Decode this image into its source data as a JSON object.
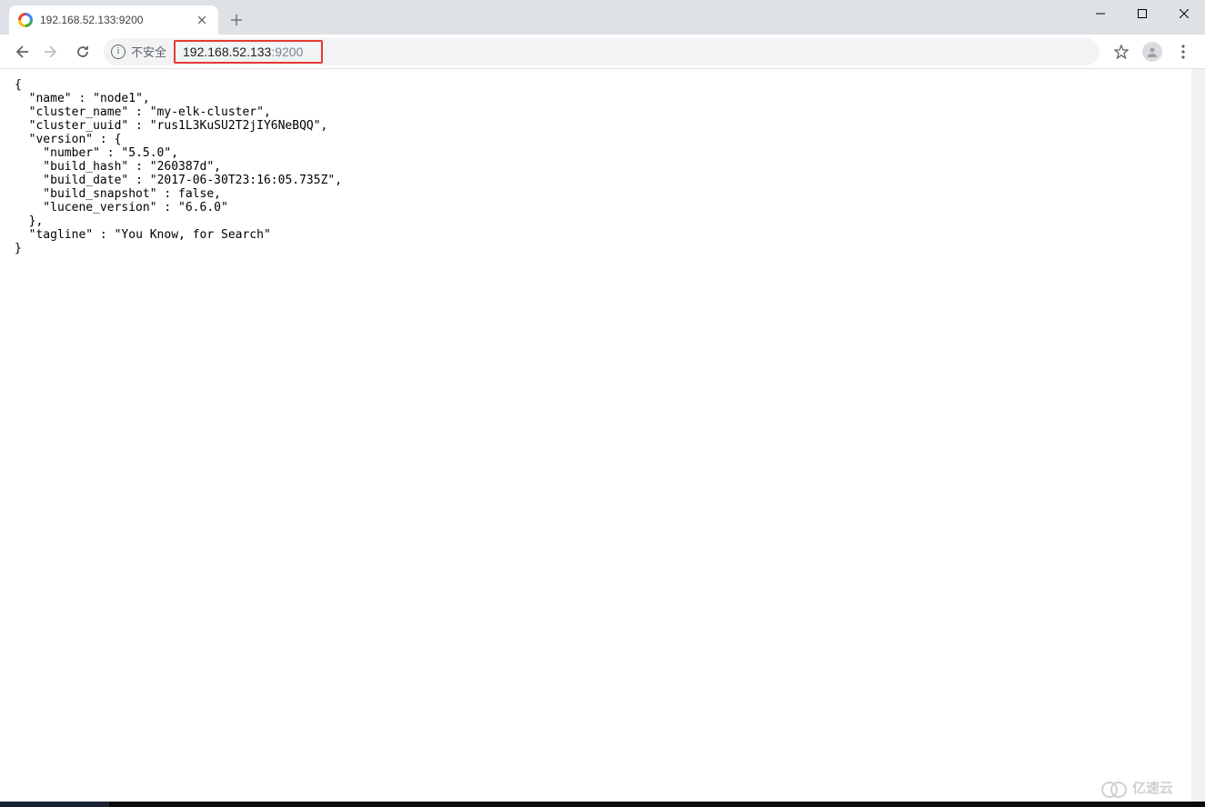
{
  "tab": {
    "title": "192.168.52.133:9200"
  },
  "toolbar": {
    "security_label": "不安全",
    "url_host": "192.168.52.133",
    "url_port": ":9200"
  },
  "response": {
    "name_key": "name",
    "name_val": "node1",
    "cluster_name_key": "cluster_name",
    "cluster_name_val": "my-elk-cluster",
    "cluster_uuid_key": "cluster_uuid",
    "cluster_uuid_val": "rus1L3KuSU2T2jIY6NeBQQ",
    "version_key": "version",
    "number_key": "number",
    "number_val": "5.5.0",
    "build_hash_key": "build_hash",
    "build_hash_val": "260387d",
    "build_date_key": "build_date",
    "build_date_val": "2017-06-30T23:16:05.735Z",
    "build_snapshot_key": "build_snapshot",
    "build_snapshot_val": "false",
    "lucene_version_key": "lucene_version",
    "lucene_version_val": "6.6.0",
    "tagline_key": "tagline",
    "tagline_val": "You Know, for Search"
  },
  "watermark": {
    "text": "亿速云"
  }
}
